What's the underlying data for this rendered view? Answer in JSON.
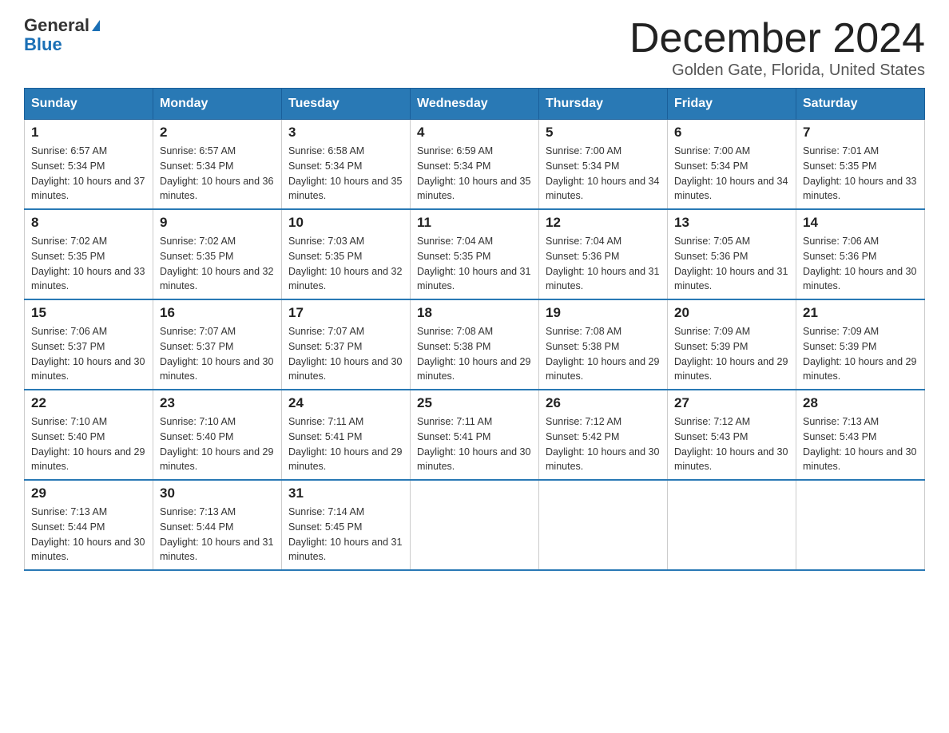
{
  "logo": {
    "general": "General",
    "blue": "Blue"
  },
  "header": {
    "month": "December 2024",
    "location": "Golden Gate, Florida, United States"
  },
  "days_of_week": [
    "Sunday",
    "Monday",
    "Tuesday",
    "Wednesday",
    "Thursday",
    "Friday",
    "Saturday"
  ],
  "weeks": [
    [
      {
        "day": "1",
        "sunrise": "6:57 AM",
        "sunset": "5:34 PM",
        "daylight": "10 hours and 37 minutes."
      },
      {
        "day": "2",
        "sunrise": "6:57 AM",
        "sunset": "5:34 PM",
        "daylight": "10 hours and 36 minutes."
      },
      {
        "day": "3",
        "sunrise": "6:58 AM",
        "sunset": "5:34 PM",
        "daylight": "10 hours and 35 minutes."
      },
      {
        "day": "4",
        "sunrise": "6:59 AM",
        "sunset": "5:34 PM",
        "daylight": "10 hours and 35 minutes."
      },
      {
        "day": "5",
        "sunrise": "7:00 AM",
        "sunset": "5:34 PM",
        "daylight": "10 hours and 34 minutes."
      },
      {
        "day": "6",
        "sunrise": "7:00 AM",
        "sunset": "5:34 PM",
        "daylight": "10 hours and 34 minutes."
      },
      {
        "day": "7",
        "sunrise": "7:01 AM",
        "sunset": "5:35 PM",
        "daylight": "10 hours and 33 minutes."
      }
    ],
    [
      {
        "day": "8",
        "sunrise": "7:02 AM",
        "sunset": "5:35 PM",
        "daylight": "10 hours and 33 minutes."
      },
      {
        "day": "9",
        "sunrise": "7:02 AM",
        "sunset": "5:35 PM",
        "daylight": "10 hours and 32 minutes."
      },
      {
        "day": "10",
        "sunrise": "7:03 AM",
        "sunset": "5:35 PM",
        "daylight": "10 hours and 32 minutes."
      },
      {
        "day": "11",
        "sunrise": "7:04 AM",
        "sunset": "5:35 PM",
        "daylight": "10 hours and 31 minutes."
      },
      {
        "day": "12",
        "sunrise": "7:04 AM",
        "sunset": "5:36 PM",
        "daylight": "10 hours and 31 minutes."
      },
      {
        "day": "13",
        "sunrise": "7:05 AM",
        "sunset": "5:36 PM",
        "daylight": "10 hours and 31 minutes."
      },
      {
        "day": "14",
        "sunrise": "7:06 AM",
        "sunset": "5:36 PM",
        "daylight": "10 hours and 30 minutes."
      }
    ],
    [
      {
        "day": "15",
        "sunrise": "7:06 AM",
        "sunset": "5:37 PM",
        "daylight": "10 hours and 30 minutes."
      },
      {
        "day": "16",
        "sunrise": "7:07 AM",
        "sunset": "5:37 PM",
        "daylight": "10 hours and 30 minutes."
      },
      {
        "day": "17",
        "sunrise": "7:07 AM",
        "sunset": "5:37 PM",
        "daylight": "10 hours and 30 minutes."
      },
      {
        "day": "18",
        "sunrise": "7:08 AM",
        "sunset": "5:38 PM",
        "daylight": "10 hours and 29 minutes."
      },
      {
        "day": "19",
        "sunrise": "7:08 AM",
        "sunset": "5:38 PM",
        "daylight": "10 hours and 29 minutes."
      },
      {
        "day": "20",
        "sunrise": "7:09 AM",
        "sunset": "5:39 PM",
        "daylight": "10 hours and 29 minutes."
      },
      {
        "day": "21",
        "sunrise": "7:09 AM",
        "sunset": "5:39 PM",
        "daylight": "10 hours and 29 minutes."
      }
    ],
    [
      {
        "day": "22",
        "sunrise": "7:10 AM",
        "sunset": "5:40 PM",
        "daylight": "10 hours and 29 minutes."
      },
      {
        "day": "23",
        "sunrise": "7:10 AM",
        "sunset": "5:40 PM",
        "daylight": "10 hours and 29 minutes."
      },
      {
        "day": "24",
        "sunrise": "7:11 AM",
        "sunset": "5:41 PM",
        "daylight": "10 hours and 29 minutes."
      },
      {
        "day": "25",
        "sunrise": "7:11 AM",
        "sunset": "5:41 PM",
        "daylight": "10 hours and 30 minutes."
      },
      {
        "day": "26",
        "sunrise": "7:12 AM",
        "sunset": "5:42 PM",
        "daylight": "10 hours and 30 minutes."
      },
      {
        "day": "27",
        "sunrise": "7:12 AM",
        "sunset": "5:43 PM",
        "daylight": "10 hours and 30 minutes."
      },
      {
        "day": "28",
        "sunrise": "7:13 AM",
        "sunset": "5:43 PM",
        "daylight": "10 hours and 30 minutes."
      }
    ],
    [
      {
        "day": "29",
        "sunrise": "7:13 AM",
        "sunset": "5:44 PM",
        "daylight": "10 hours and 30 minutes."
      },
      {
        "day": "30",
        "sunrise": "7:13 AM",
        "sunset": "5:44 PM",
        "daylight": "10 hours and 31 minutes."
      },
      {
        "day": "31",
        "sunrise": "7:14 AM",
        "sunset": "5:45 PM",
        "daylight": "10 hours and 31 minutes."
      },
      null,
      null,
      null,
      null
    ]
  ]
}
